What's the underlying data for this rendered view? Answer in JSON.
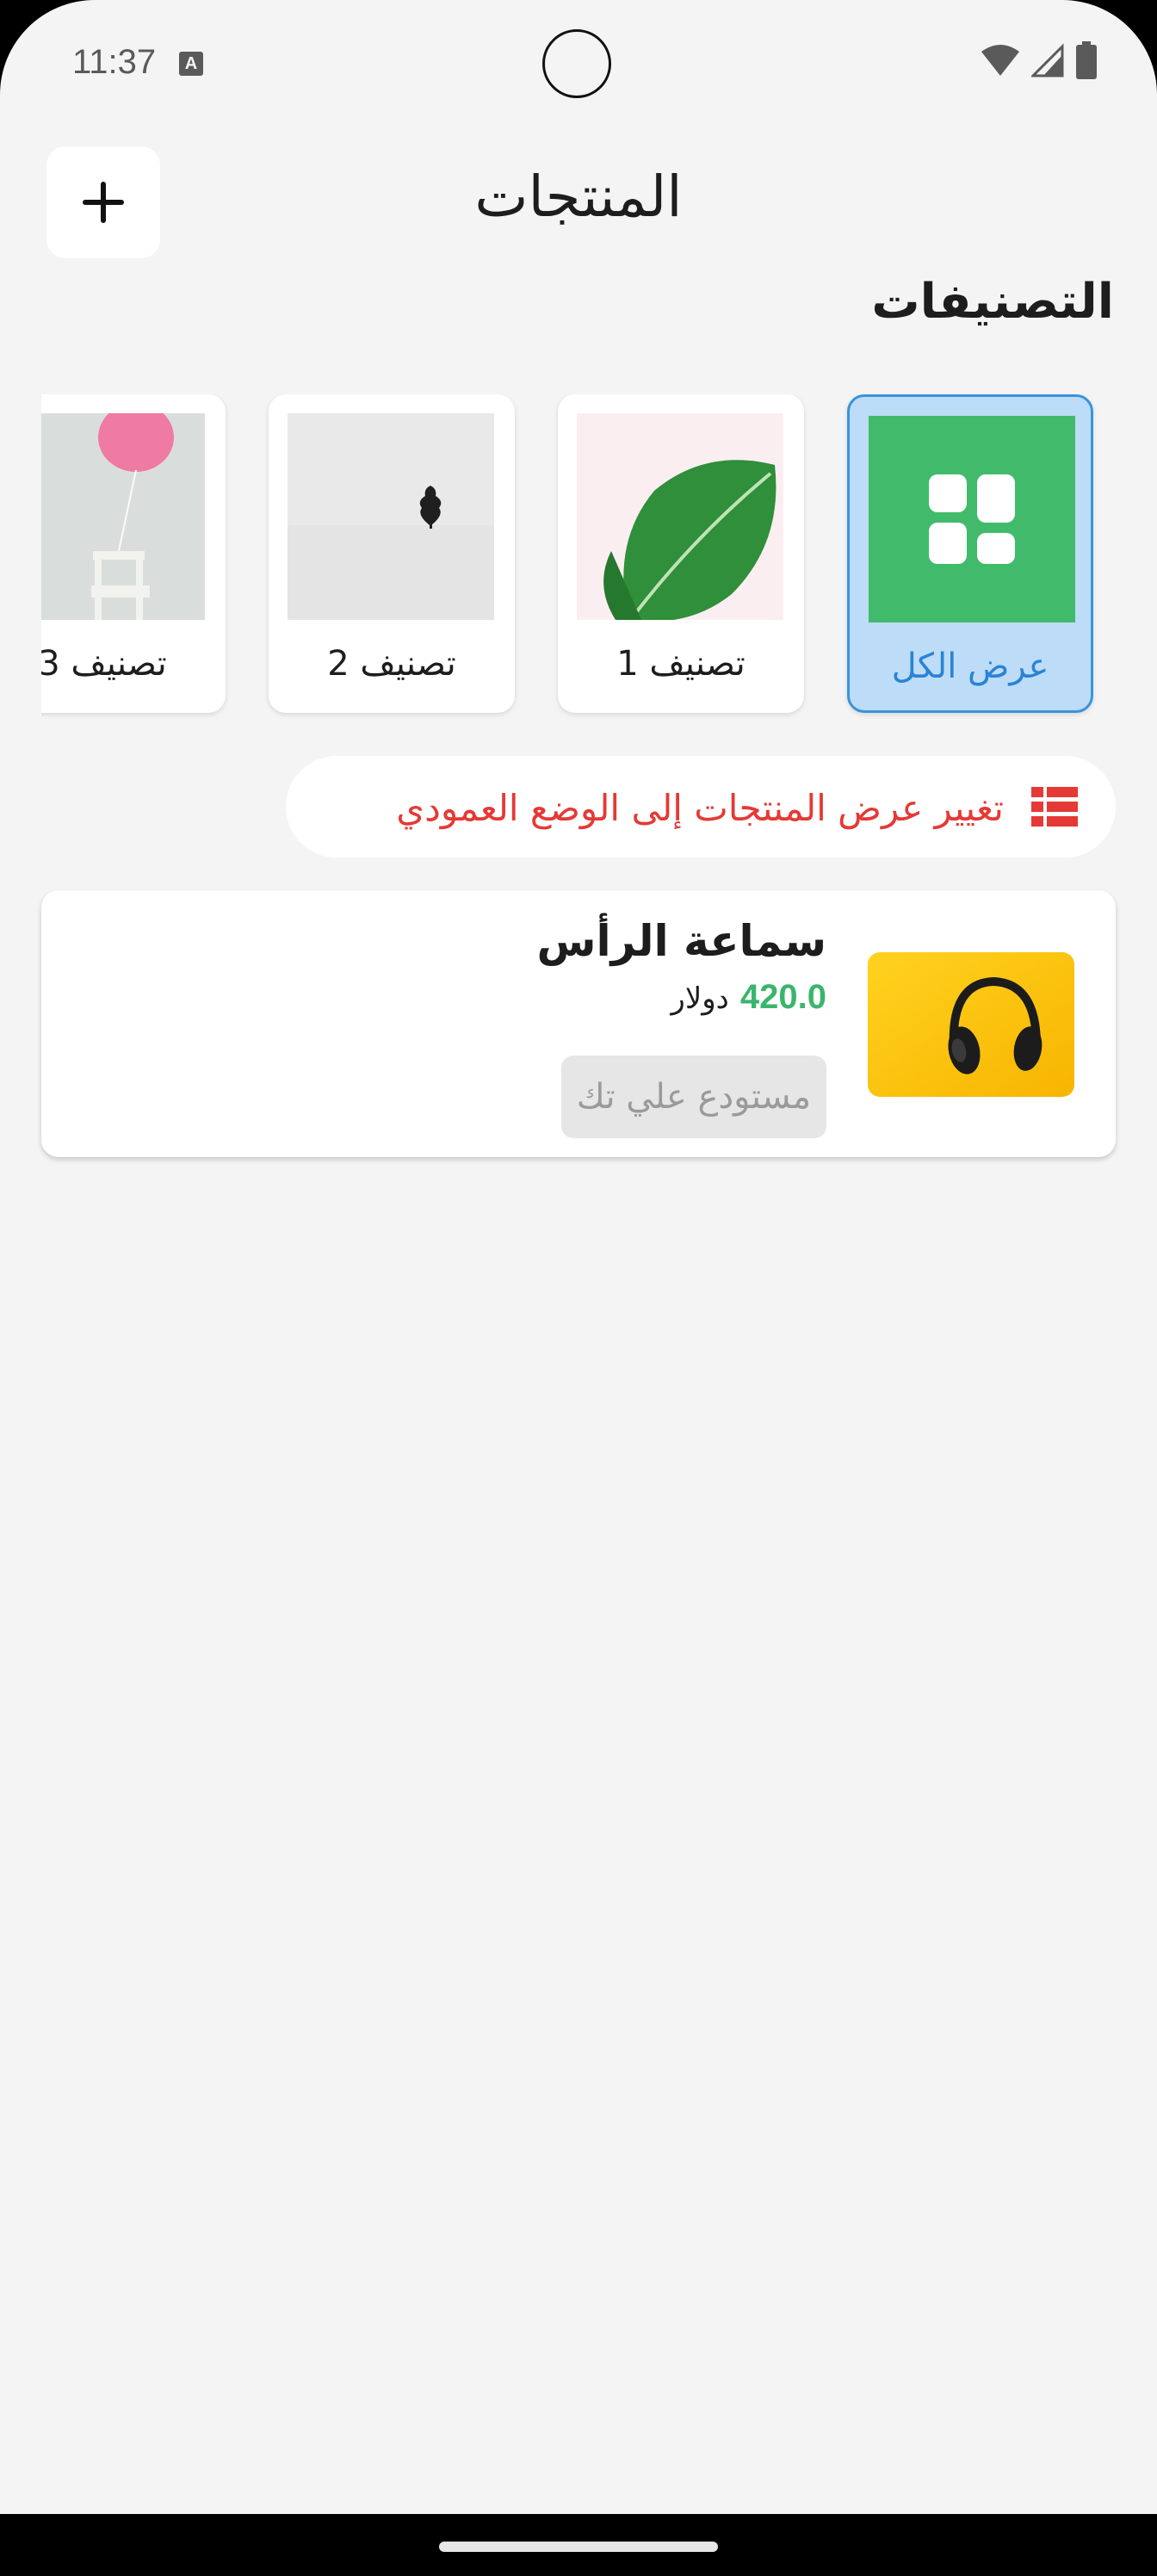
{
  "status_bar": {
    "time": "11:37",
    "indicator": "A",
    "icons": [
      "wifi-icon",
      "signal-icon",
      "battery-icon"
    ]
  },
  "header": {
    "title": "المنتجات",
    "add_icon": "plus-icon"
  },
  "categories": {
    "title": "التصنيفات",
    "items": [
      {
        "label": "عرض الكل",
        "icon": "grid-icon",
        "active": true
      },
      {
        "label": "تصنيف 1",
        "icon": "leaf-image",
        "active": false
      },
      {
        "label": "تصنيف 2",
        "icon": "tree-image",
        "active": false
      },
      {
        "label": "تصنيف 3",
        "icon": "balloon-image",
        "active": false
      }
    ]
  },
  "view_toggle": {
    "label": "تغيير عرض المنتجات إلى الوضع العمودي",
    "icon": "list-view-icon",
    "color": "#e53935"
  },
  "products": [
    {
      "name": "سماعة الرأس",
      "price": "420.0",
      "currency": "دولار",
      "warehouse": "مستودع علي تك",
      "image": "headphones-image"
    }
  ],
  "colors": {
    "accent_blue": "#2a83d4",
    "price_green": "#3bb56e",
    "background": "#f4f4f4"
  }
}
